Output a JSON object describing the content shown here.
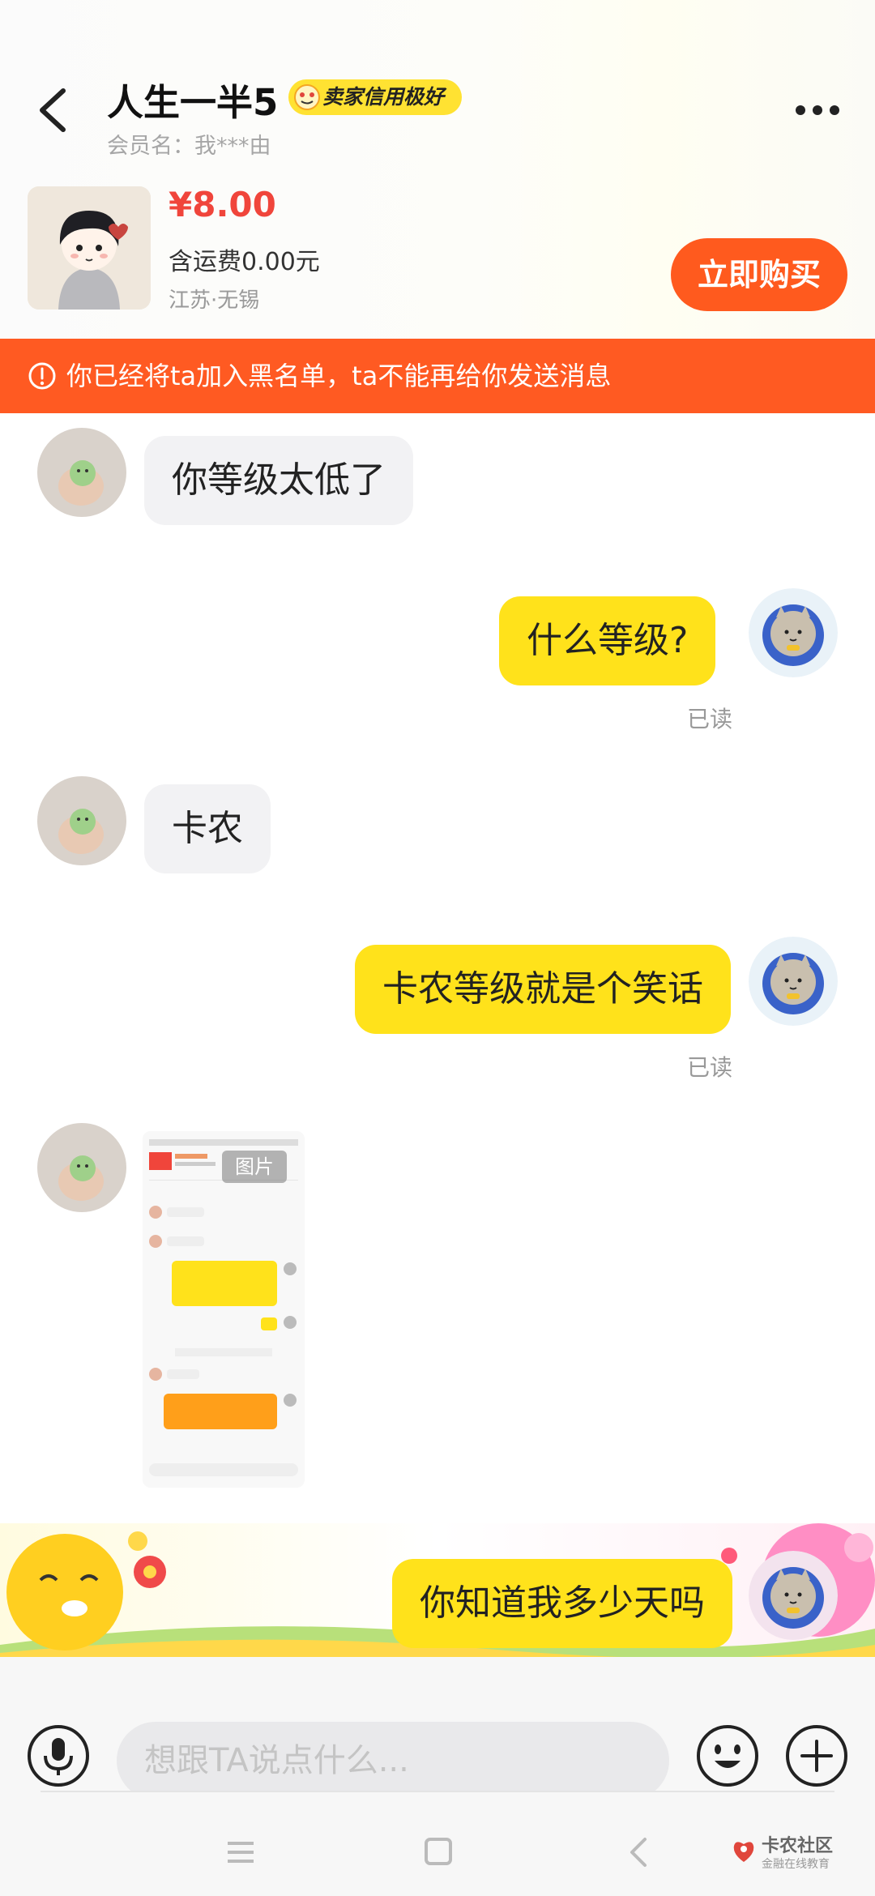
{
  "header": {
    "seller_name": "人生一半5",
    "credit_badge": "卖家信用极好",
    "member_label": "会员名：",
    "member_name": "我***由"
  },
  "product": {
    "price": "¥8.00",
    "shipping": "含运费0.00元",
    "location": "江苏·无锡",
    "buy_button": "立即购买"
  },
  "block_notice": "你已经将ta加入黑名单，ta不能再给你发送消息",
  "messages": [
    {
      "side": "left",
      "text": "你等级太低了"
    },
    {
      "side": "right",
      "text": "什么等级?",
      "status": "已读"
    },
    {
      "side": "left",
      "text": "卡农"
    },
    {
      "side": "right",
      "text": "卡农等级就是个笑话",
      "status": "已读"
    },
    {
      "side": "left",
      "type": "image",
      "tag": "图片"
    },
    {
      "side": "right",
      "text": "你知道我多少天吗"
    }
  ],
  "composer": {
    "placeholder": "想跟TA说点什么..."
  },
  "watermark": {
    "title": "卡农社区",
    "subtitle": "金融在线教育"
  },
  "colors": {
    "accent_yellow": "#ffe21b",
    "buy_orange": "#ff5a1e",
    "banner_orange": "#ff5a22",
    "price_red": "#f0453b"
  }
}
